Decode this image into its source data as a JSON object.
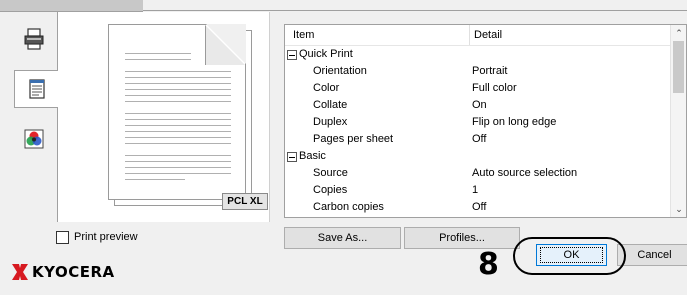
{
  "table": {
    "headers": {
      "item": "Item",
      "detail": "Detail"
    },
    "groups": [
      {
        "label": "Quick Print",
        "rows": [
          {
            "item": "Orientation",
            "detail": "Portrait"
          },
          {
            "item": "Color",
            "detail": "Full color"
          },
          {
            "item": "Collate",
            "detail": "On"
          },
          {
            "item": "Duplex",
            "detail": "Flip on long edge"
          },
          {
            "item": "Pages per sheet",
            "detail": "Off"
          }
        ]
      },
      {
        "label": "Basic",
        "rows": [
          {
            "item": "Source",
            "detail": "Auto source selection"
          },
          {
            "item": "Copies",
            "detail": "1"
          },
          {
            "item": "Carbon copies",
            "detail": "Off"
          }
        ]
      }
    ]
  },
  "preview": {
    "language_badge": "PCL XL"
  },
  "options": {
    "print_preview_label": "Print preview",
    "print_preview_checked": false
  },
  "buttons": {
    "save_as": "Save As...",
    "profiles": "Profiles...",
    "ok": "OK",
    "cancel": "Cancel"
  },
  "annotation": {
    "step_number": "8"
  },
  "brand": {
    "name": "KYOCERA",
    "color": "#d71920"
  },
  "icons": {
    "tab_printer": "printer-icon",
    "tab_document": "document-icon",
    "tab_color": "color-icon",
    "scroll_up": "chevron-up-icon",
    "scroll_down": "chevron-down-icon",
    "collapse": "minus-box-icon"
  },
  "colors": {
    "ok_border": "#0078d7",
    "ok_fill": "#e5f1fb"
  }
}
